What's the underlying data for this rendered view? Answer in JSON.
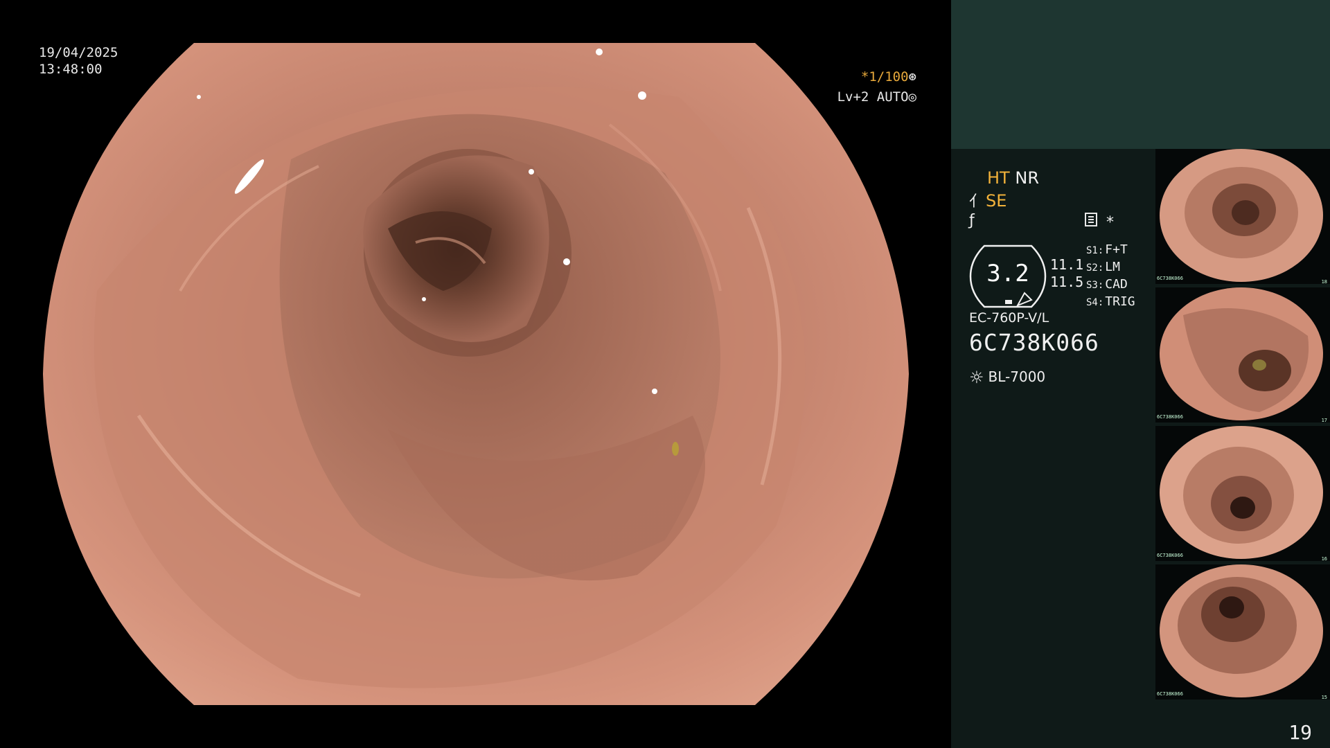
{
  "osd": {
    "date": "19/04/2025",
    "time": "13:48:00",
    "shutter": "*1/100",
    "shutter_icon": "shutter-icon",
    "level": "Lv+2 AUTO",
    "level_icon": "iris-icon"
  },
  "panel": {
    "mode_ht": "HT",
    "mode_nr": "NR",
    "mode_se": "SE",
    "se_icon": "enhance-icon",
    "mode3_icon": "structure-icon",
    "settings_icon": "settings-icon",
    "star": "*",
    "gauge": {
      "value": "3.2",
      "value_a": "11.1",
      "value_b": "11.5"
    },
    "switches": [
      {
        "key": "S1:",
        "value": "F+T"
      },
      {
        "key": "S2:",
        "value": "LM"
      },
      {
        "key": "S3:",
        "value": "CAD"
      },
      {
        "key": "S4:",
        "value": "TRIG"
      }
    ],
    "scope_model": "EC-760P-V/L",
    "scope_serial": "6C738K066",
    "light_icon": "light-source-icon",
    "light_source": "BL-7000"
  },
  "thumbnails": [
    {
      "number": "18",
      "serial": "6C738K066"
    },
    {
      "number": "17",
      "serial": "6C738K066"
    },
    {
      "number": "16",
      "serial": "6C738K066"
    },
    {
      "number": "15",
      "serial": "6C738K066"
    }
  ],
  "page_number": "19",
  "colors": {
    "accent": "#f2b23a",
    "panel_bg": "#0f1a18",
    "panel_top": "#1e3631",
    "mucosa": "#c98a72"
  }
}
